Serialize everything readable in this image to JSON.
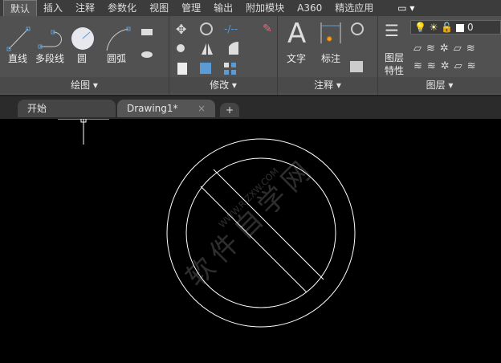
{
  "ribbon_tabs": [
    "默认",
    "插入",
    "注释",
    "参数化",
    "视图",
    "管理",
    "输出",
    "附加模块",
    "A360",
    "精选应用"
  ],
  "draw_panel": {
    "title": "绘图",
    "line": "直线",
    "polyline": "多段线",
    "circle": "圆",
    "arc": "圆弧"
  },
  "modify_panel": {
    "title": "修改"
  },
  "annotation_panel": {
    "title": "注释",
    "text": "文字",
    "dimension": "标注"
  },
  "layers_panel": {
    "title": "图层",
    "properties": "图层特性",
    "current_layer": "0"
  },
  "doc_tabs": {
    "start": "开始",
    "drawing": "Drawing1*",
    "close": "×",
    "new": "+"
  },
  "watermark": {
    "text": "软件自学网",
    "url": "WWW.RJZXW.COM"
  },
  "colors": {
    "ribbon": "#515151",
    "canvas": "#000000",
    "accent": "#5b9bd5"
  }
}
